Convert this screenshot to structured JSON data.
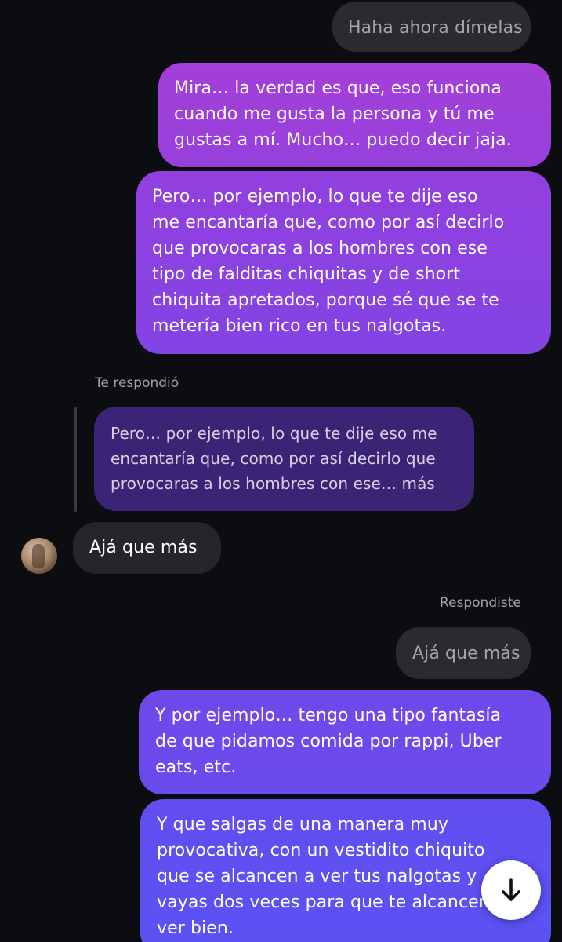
{
  "chat": {
    "msg1": {
      "text": "Haha ahora dímelas"
    },
    "msg2": {
      "lines": [
        "Mira… la verdad es que, eso funciona",
        "cuando me gusta la persona y tú me",
        "gustas a mí. Mucho… puedo decir jaja."
      ]
    },
    "msg3": {
      "lines": [
        "Pero… por ejemplo, lo que te dije eso",
        "me encantaría que, como por así decirlo",
        "que provocaras a los hombres con ese",
        "tipo de falditas chiquitas y de short",
        "chiquita apretados, porque sé que se te",
        "metería bien rico en tus nalgotas."
      ]
    },
    "reply_label_them": "Te respondió",
    "quoted_reply": {
      "lines": [
        "Pero… por ejemplo, lo que te dije eso me",
        "encantaría que, como por así decirlo que",
        "provocaras a los hombres con ese… más"
      ]
    },
    "msg4": {
      "text": "Ajá que más"
    },
    "reply_label_you": "Respondiste",
    "quoted_mine": {
      "text": "Ajá que más"
    },
    "msg5": {
      "lines": [
        "Y por ejemplo… tengo una tipo fantasía",
        "de que pidamos comida por rappi, Uber",
        "eats, etc."
      ]
    },
    "msg6": {
      "lines": [
        "Y que salgas de una manera muy",
        "provocativa, con un vestidito chiquito",
        "que se alcancen a ver tus nalgotas y",
        "vayas dos veces para que te alcancen a",
        "ver bien."
      ]
    }
  },
  "icons": {
    "scroll_down": "arrow-down-icon",
    "avatar": "contact-avatar"
  },
  "colors": {
    "background": "#0c0d10",
    "incoming_bubble": "#24262b",
    "quoted_bubble": "#2a2b30",
    "outgoing_gradient_top": "#a63fd8",
    "outgoing_gradient_bottom": "#6a50f0",
    "meta_text": "#a3a5ab"
  }
}
